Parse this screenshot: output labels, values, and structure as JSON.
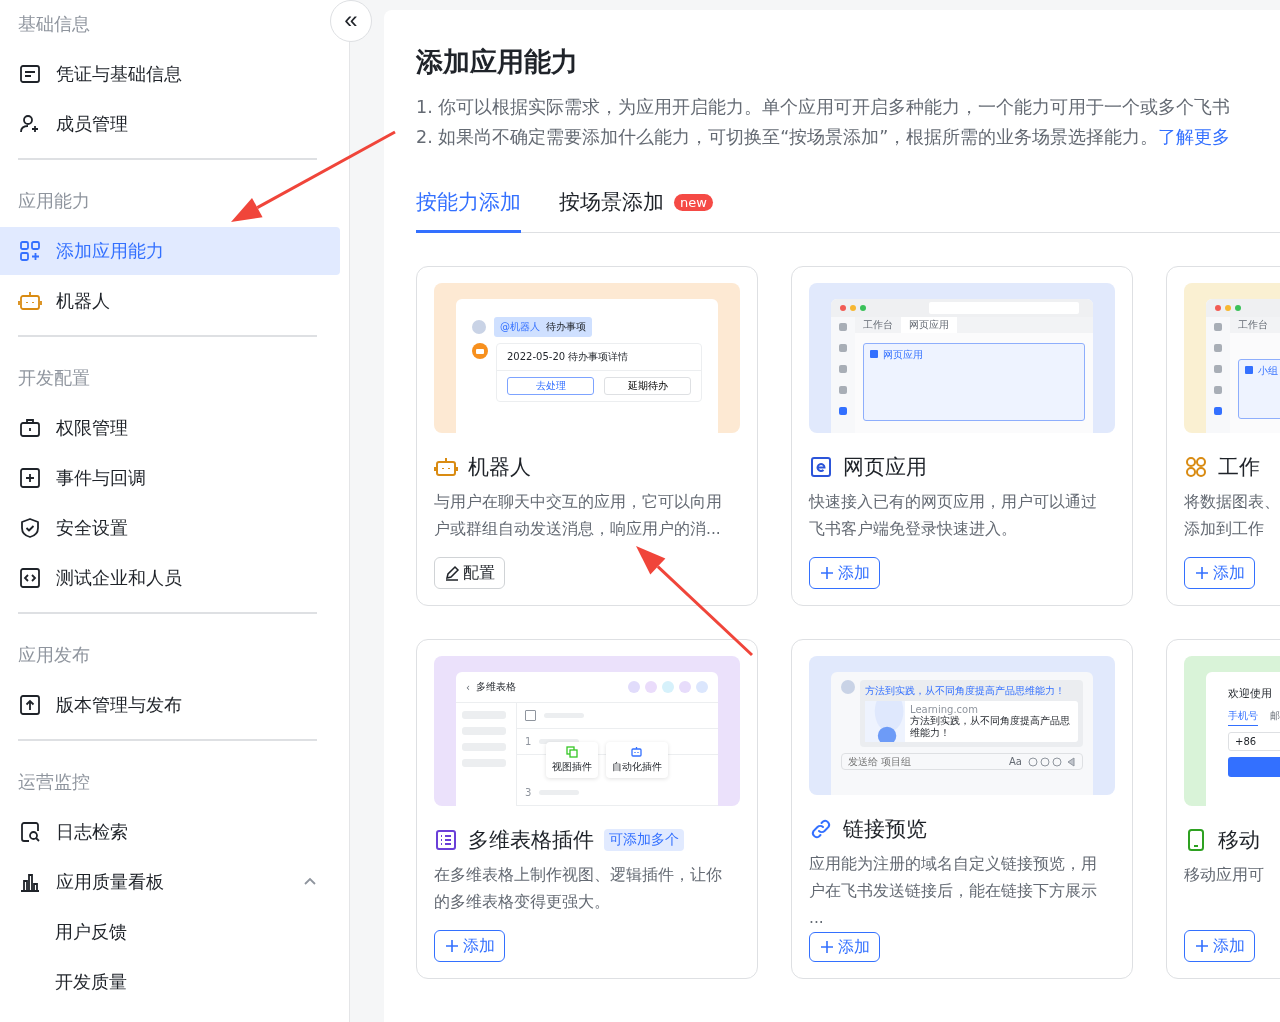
{
  "sidebar": {
    "collapse_label": "«",
    "sections": [
      {
        "title": "基础信息",
        "items": [
          {
            "label": "凭证与基础信息",
            "selected": false
          },
          {
            "label": "成员管理",
            "selected": false
          }
        ]
      },
      {
        "title": "应用能力",
        "items": [
          {
            "label": "添加应用能力",
            "selected": true
          },
          {
            "label": "机器人",
            "selected": false
          }
        ]
      },
      {
        "title": "开发配置",
        "items": [
          {
            "label": "权限管理",
            "selected": false
          },
          {
            "label": "事件与回调",
            "selected": false
          },
          {
            "label": "安全设置",
            "selected": false
          },
          {
            "label": "测试企业和人员",
            "selected": false
          }
        ]
      },
      {
        "title": "应用发布",
        "items": [
          {
            "label": "版本管理与发布",
            "selected": false
          }
        ]
      },
      {
        "title": "运营监控",
        "items": [
          {
            "label": "日志检索",
            "selected": false
          },
          {
            "label": "应用质量看板",
            "selected": false,
            "expanded": true,
            "children": [
              {
                "label": "用户反馈",
                "selected": false
              },
              {
                "label": "开发质量",
                "selected": false
              }
            ]
          }
        ]
      }
    ]
  },
  "main": {
    "title": "添加应用能力",
    "intro": [
      "1. 你可以根据实际需求，为应用开启能力。单个应用可开启多种能力，一个能力可用于一个或多个飞书",
      "2. 如果尚不确定需要添加什么能力，可切换至“按场景添加”，根据所需的业务场景选择能力。"
    ],
    "intro_link": "了解更多",
    "tabs": [
      {
        "label": "按能力添加",
        "selected": true
      },
      {
        "label": "按场景添加",
        "selected": false,
        "badge": "new"
      }
    ],
    "cards": [
      {
        "kind": "bot",
        "title": "机器人",
        "description": "与用户在聊天中交互的应用，它可以向用户或群组自动发送消息，响应用户的消...",
        "button": {
          "kind": "configure",
          "label": "配置"
        },
        "color": "#fde9d3",
        "preview": {
          "mention": "@机器人",
          "text": "待办事项",
          "message": "2022-05-20 待办事项详情",
          "actions": [
            "去处理",
            "延期待办"
          ]
        }
      },
      {
        "kind": "web",
        "title": "网页应用",
        "description": "快速接入已有的网页应用，用户可以通过飞书客户端免登录快速进入。",
        "button": {
          "kind": "add",
          "label": "添加"
        },
        "color": "#e1e9fc",
        "preview": {
          "tabs": [
            "工作台",
            "网页应用"
          ],
          "content": "网页应用"
        }
      },
      {
        "kind": "workbench",
        "title": "工作",
        "description": [
          "将数据图表、",
          "添加到工作"
        ],
        "button": {
          "kind": "add",
          "label": "添加"
        },
        "color": "#faf0d2",
        "preview": {
          "tabs": [
            "工作台"
          ],
          "content": "小组"
        }
      },
      {
        "kind": "table",
        "title": "多维表格插件",
        "badge": "可添加多个",
        "description": "在多维表格上制作视图、逻辑插件，让你的多维表格变得更强大。",
        "button": {
          "kind": "add",
          "label": "添加"
        },
        "color": "#ebe1fb",
        "preview": {
          "back_label": "‹",
          "checkbox_checked": false,
          "title": "多维表格",
          "rows": [
            "1",
            "3"
          ],
          "plugins": [
            "视图插件",
            "自动化插件"
          ]
        }
      },
      {
        "kind": "link",
        "title": "链接预览",
        "description": "应用能为注册的域名自定义链接预览，用户在飞书发送链接后，能在链接下方展示...",
        "button": {
          "kind": "add",
          "label": "添加"
        },
        "color": "#e1e9fc",
        "preview": {
          "link_title": "方法到实践，从不同角度提高产品思维能力！",
          "site": "Learning.com",
          "card_title": "方法到实践，从不同角度提高产品思维能力！",
          "placeholder": "发送给 项目组",
          "format_label": "Aa"
        }
      },
      {
        "kind": "mobile",
        "title": "移动",
        "description": "移动应用可",
        "button": {
          "kind": "add",
          "label": "添加"
        },
        "color": "#d9f3d8",
        "preview": {
          "title": "欢迎使用",
          "tabs": [
            {
              "label": "手机号",
              "selected": true
            },
            {
              "label": "邮",
              "selected": false
            }
          ],
          "country_code": "+86"
        }
      }
    ]
  },
  "annotation_arrows": [
    {
      "kind": "arrow"
    },
    {
      "kind": "arrow"
    }
  ]
}
